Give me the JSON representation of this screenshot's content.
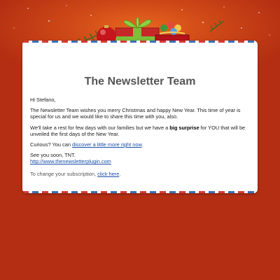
{
  "header": {
    "title": "The Newsletter Team"
  },
  "email": {
    "greeting": "Hi Stefano,",
    "para1": "The Newsletter Team wishes you merry Christmas and happy New Year. This time of year is special for us and we would like to share this time with you, also.",
    "para2_before": "We'll take a rest for few days with our families but we have a ",
    "para2_bold": "big surprise",
    "para2_after": " for YOU that will be unveiled the first days of the New Year.",
    "curious_text": "Curious? You can ",
    "curious_link": "discover a little more right now",
    "curious_end": ".",
    "signoff": "See you soon, TNT.",
    "site_link": "http://www.thenewsletterplugin.com",
    "subscription_text": "To change your subscription, ",
    "subscription_link": "click here",
    "subscription_end": "."
  },
  "colors": {
    "background": "#b32e12",
    "link": "#1a4fa8",
    "title": "#555555"
  },
  "icons": [
    "gift-icon",
    "ornament-icon",
    "candy-bag-icon",
    "pine-branch-icon"
  ]
}
